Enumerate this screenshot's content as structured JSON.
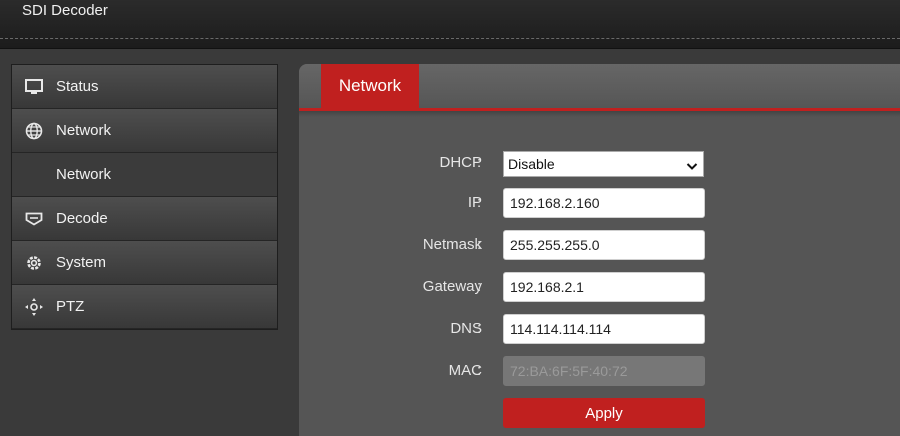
{
  "app": {
    "title": "SDI Decoder"
  },
  "sidebar": {
    "items": [
      {
        "label": "Status",
        "icon": "monitor-icon"
      },
      {
        "label": "Network",
        "icon": "globe-icon"
      },
      {
        "label": "Network",
        "icon": ""
      },
      {
        "label": "Decode",
        "icon": "decode-icon"
      },
      {
        "label": "System",
        "icon": "gear-icon"
      },
      {
        "label": "PTZ",
        "icon": "ptz-icon"
      }
    ]
  },
  "panel": {
    "tab": "Network",
    "form": {
      "colon": ":",
      "dhcp": {
        "label": "DHCP",
        "value": "Disable"
      },
      "ip": {
        "label": "IP",
        "value": "192.168.2.160"
      },
      "netmask": {
        "label": "Netmask",
        "value": "255.255.255.0"
      },
      "gateway": {
        "label": "Gateway",
        "value": "192.168.2.1"
      },
      "dns": {
        "label": "DNS",
        "value": "114.114.114.114"
      },
      "mac": {
        "label": "MAC",
        "value": "72:BA:6F:5F:40:72"
      },
      "apply": "Apply"
    }
  },
  "colors": {
    "accent": "#c0201f",
    "panel": "#555555",
    "background": "#3a3a3a"
  }
}
